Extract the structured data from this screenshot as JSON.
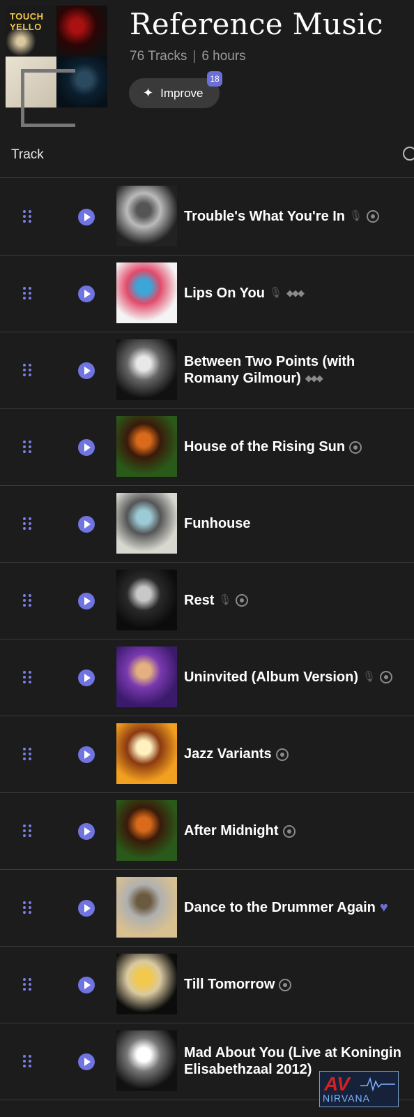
{
  "playlist": {
    "title": "Reference Music",
    "track_count": "76 Tracks",
    "separator": "|",
    "duration": "6 hours",
    "mosaic_text": "TOUCH YELLO"
  },
  "improve": {
    "label": "Improve",
    "badge": "18"
  },
  "columns": {
    "track": "Track"
  },
  "tracks": [
    {
      "name": "Trouble's What You're In",
      "icons": [
        "mic-icon",
        "mq-icon"
      ],
      "art": [
        "#222",
        "#555",
        "#bbb"
      ]
    },
    {
      "name": "Lips On You",
      "icons": [
        "mic-icon",
        "tidal-icon"
      ],
      "art": [
        "#f4f4f4",
        "#3aa7d8",
        "#e24a6a"
      ]
    },
    {
      "name": "Between Two Points (with Romany Gilmour)",
      "icons": [
        "tidal-icon"
      ],
      "art": [
        "#111",
        "#e8e8e8",
        "#666"
      ]
    },
    {
      "name": "House of the Rising Sun",
      "icons": [
        "mq-icon"
      ],
      "art": [
        "#2a5a1a",
        "#d86a1a",
        "#3a1a0a"
      ]
    },
    {
      "name": "Funhouse",
      "icons": [],
      "art": [
        "#d8d8d0",
        "#9ccad6",
        "#555"
      ]
    },
    {
      "name": "Rest",
      "icons": [
        "mic-icon",
        "mq-icon"
      ],
      "art": [
        "#0c0c0c",
        "#c8c8c8",
        "#2a2a2a"
      ]
    },
    {
      "name": "Uninvited (Album Version)",
      "icons": [
        "mic-icon",
        "mq-icon"
      ],
      "art": [
        "#3a1a6a",
        "#e4b080",
        "#7a3ab0"
      ]
    },
    {
      "name": "Jazz Variants",
      "icons": [
        "mq-icon"
      ],
      "art": [
        "#f2a020",
        "#fff1c0",
        "#8a3a10"
      ]
    },
    {
      "name": "After Midnight",
      "icons": [
        "mq-icon"
      ],
      "art": [
        "#2a5a1a",
        "#d86a1a",
        "#3a1a0a"
      ]
    },
    {
      "name": "Dance to the Drummer Again",
      "icons": [
        "heart-icon"
      ],
      "art": [
        "#d8c090",
        "#6a5a40",
        "#b0b0b0"
      ]
    },
    {
      "name": "Till Tomorrow",
      "icons": [
        "mq-icon"
      ],
      "art": [
        "#0c0c0c",
        "#f2c94c",
        "#d9c9a0"
      ]
    },
    {
      "name": "Mad About You (Live at Koningin Elisabethzaal 2012)",
      "icons": [],
      "art": [
        "#111",
        "#ffffff",
        "#777"
      ]
    }
  ],
  "watermark": {
    "brand": "AV",
    "sub": "NIRVANA"
  },
  "colors": {
    "accent": "#6b6fd6",
    "background": "#1c1c1c",
    "divider": "#3a3a3a"
  }
}
